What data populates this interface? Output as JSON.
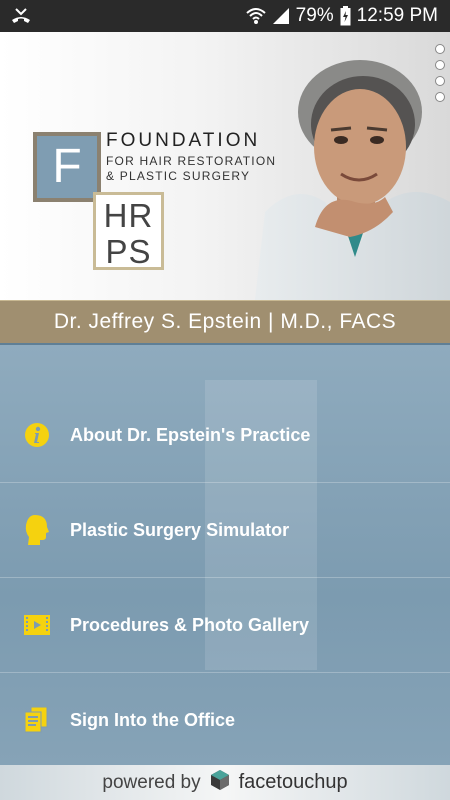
{
  "status": {
    "battery": "79%",
    "time": "12:59 PM"
  },
  "logo": {
    "letter": "F",
    "hrps_top": "HR",
    "hrps_bottom": "PS",
    "title": "FOUNDATION",
    "sub_line1": "FOR HAIR RESTORATION",
    "sub_line2": "& PLASTIC SURGERY"
  },
  "banner": {
    "text": "Dr. Jeffrey S. Epstein  |  M.D., FACS"
  },
  "menu": {
    "items": [
      {
        "label": "About Dr. Epstein's Practice",
        "icon": "info-icon"
      },
      {
        "label": "Plastic Surgery Simulator",
        "icon": "head-profile-icon"
      },
      {
        "label": "Procedures & Photo Gallery",
        "icon": "film-icon"
      },
      {
        "label": "Sign Into the Office",
        "icon": "documents-icon"
      }
    ]
  },
  "footer": {
    "powered_by": "powered by",
    "brand": "facetouchup"
  },
  "colors": {
    "accent_yellow": "#f5d20f",
    "banner": "#a08f70",
    "menu_bg": "#7f9cb0"
  }
}
